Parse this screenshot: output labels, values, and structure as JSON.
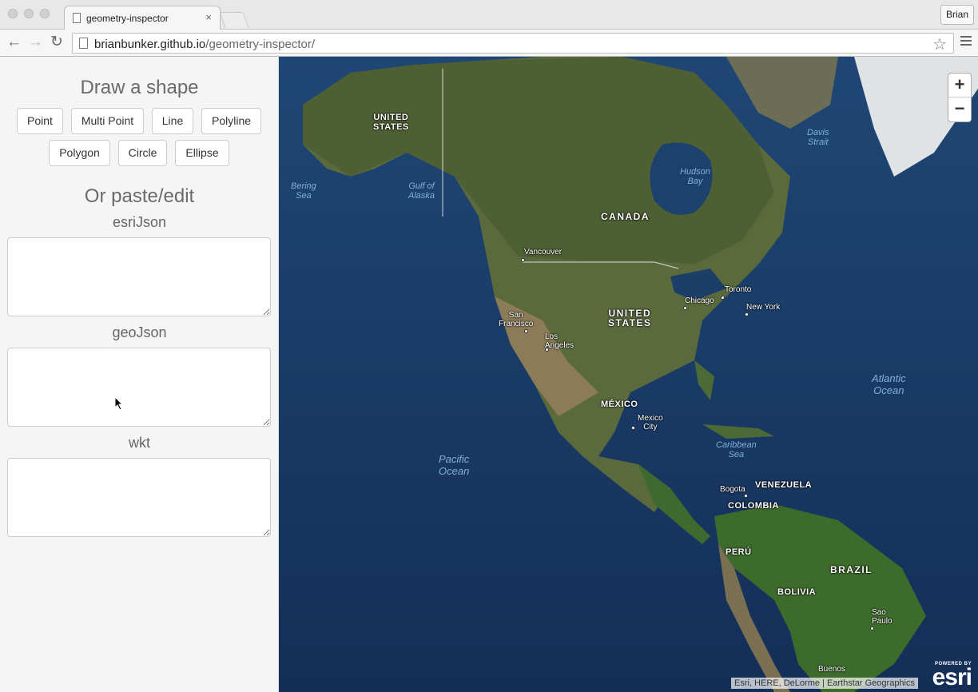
{
  "browser": {
    "tab_title": "geometry-inspector",
    "tab_close": "×",
    "profile_name": "Brian",
    "url_host": "brianbunker.github.io",
    "url_path": "/geometry-inspector/",
    "back_icon": "←",
    "forward_icon": "→",
    "reload_icon": "↻",
    "star_icon": "☆"
  },
  "sidebar": {
    "draw_heading": "Draw a shape",
    "buttons": {
      "point": "Point",
      "multipoint": "Multi Point",
      "line": "Line",
      "polyline": "Polyline",
      "polygon": "Polygon",
      "circle": "Circle",
      "ellipse": "Ellipse"
    },
    "paste_heading": "Or paste/edit",
    "esrijson_label": "esriJson",
    "esrijson_value": "",
    "geojson_label": "geoJson",
    "geojson_value": "",
    "wkt_label": "wkt",
    "wkt_value": ""
  },
  "map": {
    "countries": {
      "us_alaska": "UNITED\nSTATES",
      "canada": "CANADA",
      "us": "UNITED\nSTATES",
      "mexico": "MÉXICO",
      "venezuela": "VENEZUELA",
      "colombia": "COLOMBIA",
      "peru": "PERÚ",
      "brazil": "BRAZIL",
      "bolivia": "BOLIVIA"
    },
    "waters": {
      "bering": "Bering\nSea",
      "alaska_gulf": "Gulf of\nAlaska",
      "hudson": "Hudson\nBay",
      "davis": "Davis\nStrait",
      "atlantic": "Atlantic\nOcean",
      "pacific": "Pacific\nOcean",
      "caribbean": "Caribbean\nSea"
    },
    "cities": {
      "vancouver": "Vancouver",
      "toronto": "Toronto",
      "chicago": "Chicago",
      "new_york": "New York",
      "san_francisco": "San\nFrancisco",
      "los_angeles": "Los\nAngeles",
      "mexico_city": "Mexico\nCity",
      "bogota": "Bogota",
      "sao_paulo": "Sao\nPaulo",
      "buenos_aires": "Buenos"
    },
    "zoom_in": "+",
    "zoom_out": "−",
    "attribution": "Esri, HERE, DeLorme | Earthstar Geographics",
    "powered_by": "POWERED BY",
    "logo": "esri"
  }
}
